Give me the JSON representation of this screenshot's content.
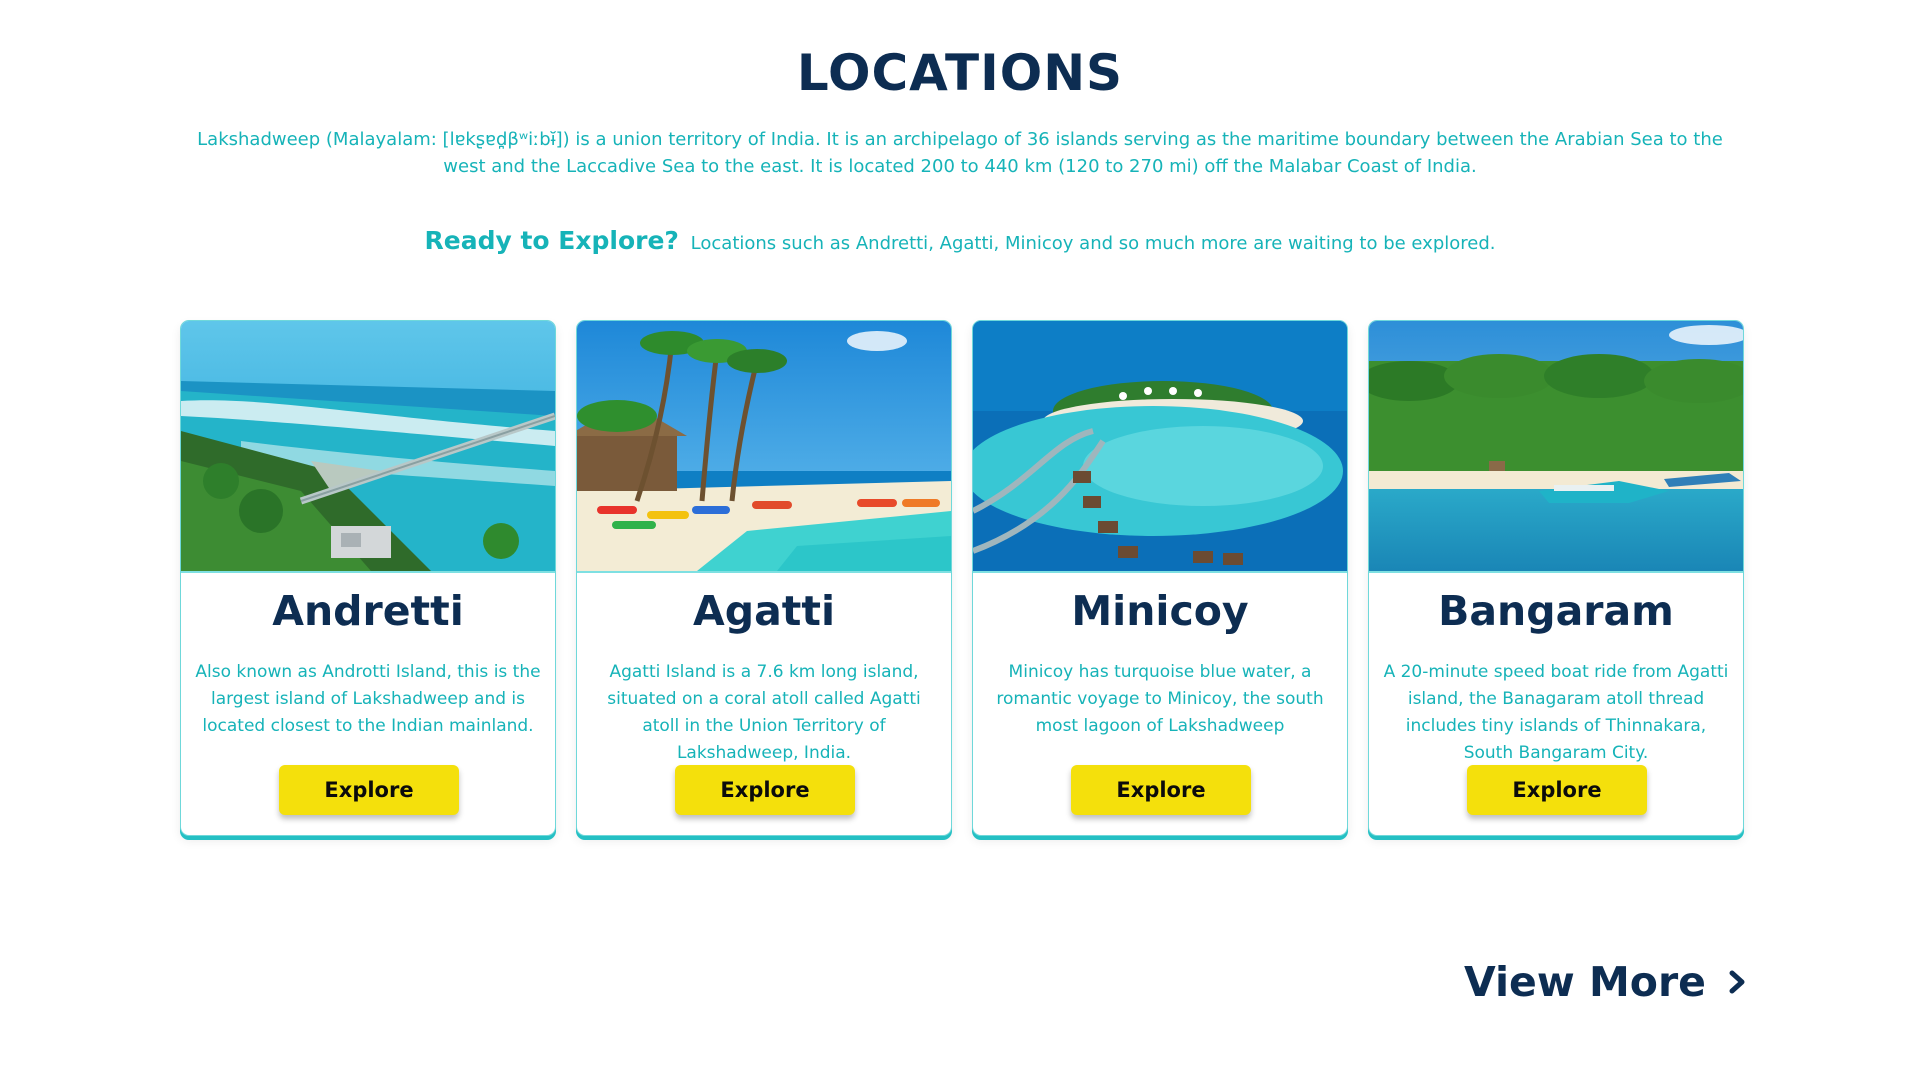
{
  "section": {
    "title": "LOCATIONS",
    "intro": "Lakshadweep (Malayalam: [lɐkʂɐd̪βʷiːbɨ̆]) is a union territory of India. It is an archipelago of 36 islands serving as the maritime boundary between the Arabian Sea to the west and the Laccadive Sea to the east. It is located 200 to 440 km (120 to 270 mi) off the Malabar Coast of India.",
    "cta_strong": "Ready to Explore?",
    "cta_text": "Locations such as Andretti, Agatti, Minicoy and so much more are waiting to be explored."
  },
  "cards": [
    {
      "title": "Andretti",
      "description": "Also known as Androtti Island, this is the largest island of Lakshadweep and is located closest to the Indian mainland.",
      "button": "Explore",
      "image": "aerial-island-bridge"
    },
    {
      "title": "Agatti",
      "description": "Agatti Island is a 7.6 km long island, situated on a coral atoll called Agatti atoll in the Union Territory of Lakshadweep, India.",
      "button": "Explore",
      "image": "beach-kayaks-palms"
    },
    {
      "title": "Minicoy",
      "description": "Minicoy has turquoise blue water, a romantic voyage to Minicoy, the south most lagoon of Lakshadweep",
      "button": "Explore",
      "image": "overwater-villas"
    },
    {
      "title": "Bangaram",
      "description": "A 20-minute speed boat ride from Agatti island, the Banagaram atoll thread includes tiny islands of Thinnakara, South Bangaram City.",
      "button": "Explore",
      "image": "palm-beach-boats"
    }
  ],
  "view_more": {
    "label": "View More",
    "icon": "chevron-right-icon"
  },
  "colors": {
    "heading": "#0d2d52",
    "accent": "#16b3b8",
    "button": "#f4e00c",
    "card_border": "#6fd8da"
  }
}
